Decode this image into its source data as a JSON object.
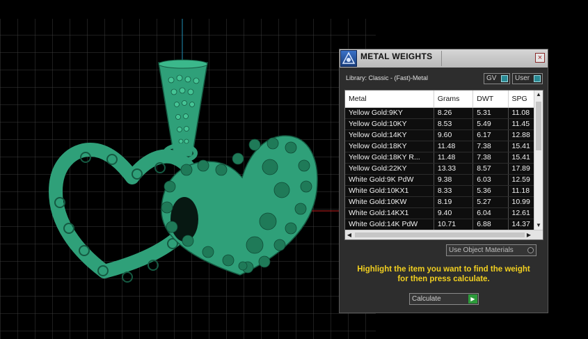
{
  "dialog": {
    "title": "METAL WEIGHTS",
    "close": "×",
    "library_label": "Library: Classic - (Fast)-Metal",
    "gv_toggle": "GV",
    "user_toggle": "User",
    "columns": [
      "Metal",
      "Grams",
      "DWT",
      "SPG"
    ],
    "rows": [
      [
        "Yellow Gold:9KY",
        "8.26",
        "5.31",
        "11.08"
      ],
      [
        "Yellow Gold:10KY",
        "8.53",
        "5.49",
        "11.45"
      ],
      [
        "Yellow Gold:14KY",
        "9.60",
        "6.17",
        "12.88"
      ],
      [
        "Yellow Gold:18KY",
        "11.48",
        "7.38",
        "15.41"
      ],
      [
        "Yellow Gold:18KY R...",
        "11.48",
        "7.38",
        "15.41"
      ],
      [
        "Yellow Gold:22KY",
        "13.33",
        "8.57",
        "17.89"
      ],
      [
        "White Gold:9K PdW",
        "9.38",
        "6.03",
        "12.59"
      ],
      [
        "White Gold:10KX1",
        "8.33",
        "5.36",
        "11.18"
      ],
      [
        "White Gold:10KW",
        "8.19",
        "5.27",
        "10.99"
      ],
      [
        "White Gold:14KX1",
        "9.40",
        "6.04",
        "12.61"
      ],
      [
        "White Gold:14K PdW",
        "10.71",
        "6.88",
        "14.37"
      ]
    ],
    "use_object_materials": "Use Object Materials",
    "instruction_line1": "Highlight the item you want to find the weight",
    "instruction_line2": "for then press calculate.",
    "calculate": "Calculate",
    "scroll_up": "▲",
    "scroll_down": "▼",
    "scroll_left": "◀",
    "scroll_right": "▶",
    "go_arrow": "▶"
  },
  "viewport": {
    "model_color": "#2fa079",
    "grid_color": "#3d3d3d",
    "axis_y_color": "#1f8fb8",
    "axis_x_color": "#c82020"
  }
}
